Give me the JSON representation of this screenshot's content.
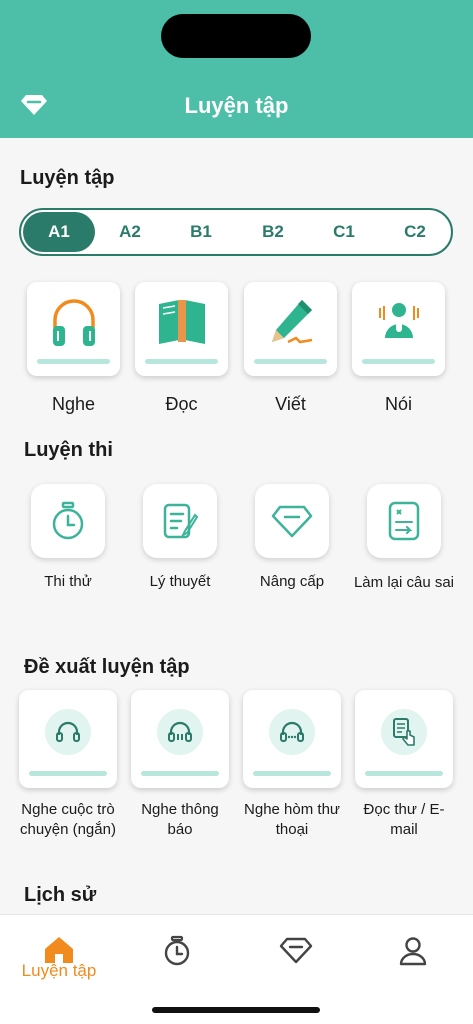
{
  "header": {
    "title": "Luyện tập",
    "gem_icon": "diamond-icon",
    "color": "#4dbfa8"
  },
  "practice": {
    "title": "Luyện tập",
    "levels": [
      "A1",
      "A2",
      "B1",
      "B2",
      "C1",
      "C2"
    ],
    "active_level": "A1",
    "skills": [
      {
        "label": "Nghe",
        "icon": "headphones-icon"
      },
      {
        "label": "Đọc",
        "icon": "book-icon"
      },
      {
        "label": "Viết",
        "icon": "pen-icon"
      },
      {
        "label": "Nói",
        "icon": "speaker-person-icon"
      }
    ]
  },
  "exam": {
    "title": "Luyện thi",
    "items": [
      {
        "label": "Thi thử",
        "icon": "stopwatch-icon"
      },
      {
        "label": "Lý thuyết",
        "icon": "notes-pencil-icon"
      },
      {
        "label": "Nâng cấp",
        "icon": "diamond-icon"
      },
      {
        "label": "Làm lại câu sai",
        "icon": "retry-list-icon"
      }
    ]
  },
  "suggest": {
    "title": "Đề xuất luyện tập",
    "items": [
      {
        "label": "Nghe cuộc trò chuyện (ngắn)",
        "icon": "headset-icon"
      },
      {
        "label": "Nghe thông báo",
        "icon": "headset-icon"
      },
      {
        "label": "Nghe hòm thư thoại",
        "icon": "headset-icon"
      },
      {
        "label": "Đọc thư / E-mail",
        "icon": "document-tap-icon"
      }
    ]
  },
  "history": {
    "title": "Lịch sử"
  },
  "nav": {
    "items": [
      {
        "label": "Luyện tập",
        "icon": "home-icon",
        "active": true
      },
      {
        "label": "",
        "icon": "stopwatch-icon",
        "active": false
      },
      {
        "label": "",
        "icon": "diamond-icon",
        "active": false
      },
      {
        "label": "",
        "icon": "user-icon",
        "active": false
      }
    ],
    "active_color": "#f28b1e"
  }
}
